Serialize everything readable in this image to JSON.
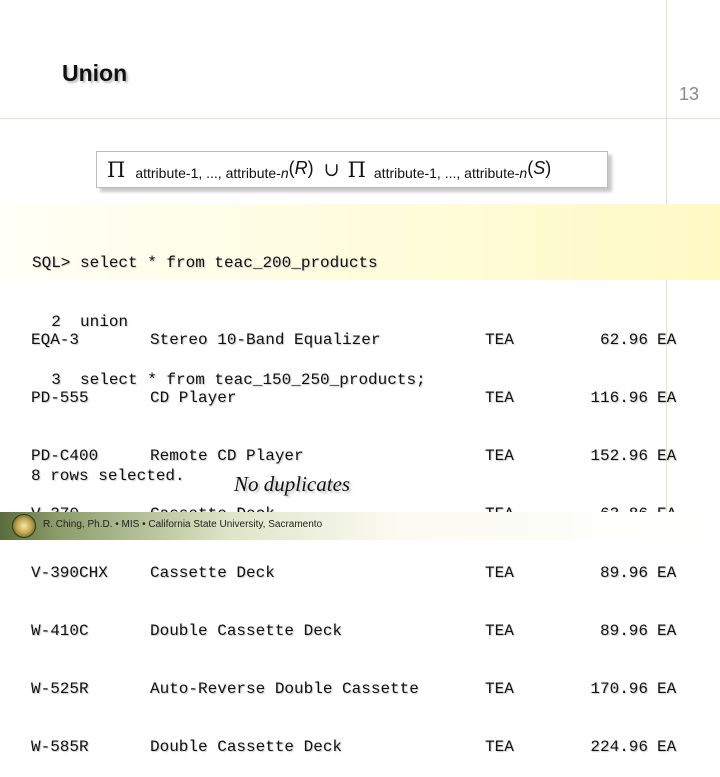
{
  "slide": {
    "title": "Union",
    "number": "13",
    "formula": {
      "pi_symbol": "Π",
      "attributes_1": "attribute-1, ..., attribute-",
      "n_1": "n",
      "open_1": "(",
      "relation_r": "R",
      "close_1": ")",
      "union_symbol": "∪",
      "attributes_2": "attribute-1, ..., attribute-",
      "n_2": "n",
      "open_2": "(",
      "relation_s": "S",
      "close_2": ")"
    },
    "sql_lines": [
      "SQL> select * from teac_200_products",
      "  2  union",
      "  3  select * from teac_150_250_products;"
    ],
    "result_rows": [
      {
        "code": "EQA-3",
        "name": "Stereo 10-Band Equalizer",
        "mfr": "TEA",
        "price": "62.96",
        "cat": "EA"
      },
      {
        "code": "PD-555",
        "name": "CD Player",
        "mfr": "TEA",
        "price": "116.96",
        "cat": "EA"
      },
      {
        "code": "PD-C400",
        "name": "Remote CD Player",
        "mfr": "TEA",
        "price": "152.96",
        "cat": "EA"
      },
      {
        "code": "V-370",
        "name": "Cassette Deck",
        "mfr": "TEA",
        "price": "63.86",
        "cat": "EA"
      },
      {
        "code": "V-390CHX",
        "name": "Cassette Deck",
        "mfr": "TEA",
        "price": "89.96",
        "cat": "EA"
      },
      {
        "code": "W-410C",
        "name": "Double Cassette Deck",
        "mfr": "TEA",
        "price": "89.96",
        "cat": "EA"
      },
      {
        "code": "W-525R",
        "name": "Auto-Reverse Double Cassette",
        "mfr": "TEA",
        "price": "170.96",
        "cat": "EA"
      },
      {
        "code": "W-585R",
        "name": "Double Cassette Deck",
        "mfr": "TEA",
        "price": "224.96",
        "cat": "EA"
      }
    ],
    "rows_selected": "8 rows selected.",
    "note": "No duplicates",
    "footer": "R. Ching, Ph.D. • MIS • California State University, Sacramento"
  },
  "colors": {
    "sql_band": "#fff9c4",
    "footer_band": "#5c6b3d",
    "slide_number": "#8a8a8a"
  },
  "icons": {
    "footer_logo": "university-seal-icon"
  }
}
